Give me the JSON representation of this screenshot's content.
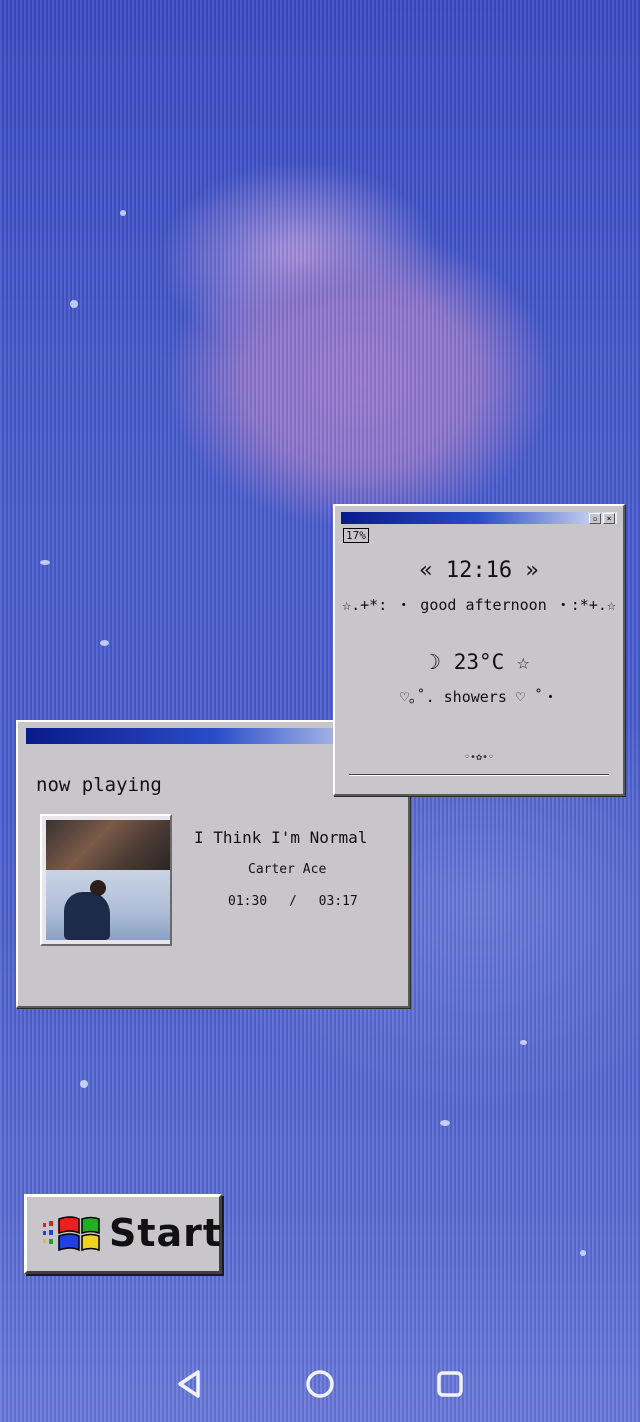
{
  "weather_widget": {
    "battery": "17%",
    "clock": "« 12:16 »",
    "greeting": "☆.+*: ・ good afternoon ・:*+.☆",
    "temperature": "☽ 23°C ☆",
    "condition": "♡｡˚. showers ♡ ˚・",
    "ornament": "◦•✿•◦"
  },
  "music_widget": {
    "heading": "now playing",
    "track_title": "I Think I'm Normal",
    "artist": "Carter Ace",
    "elapsed": "01:30",
    "separator": "/",
    "duration": "03:17"
  },
  "start_button": {
    "label": "Start"
  },
  "nav": {
    "back_icon": "back-triangle",
    "home_icon": "home-circle",
    "recents_icon": "recents-square"
  }
}
